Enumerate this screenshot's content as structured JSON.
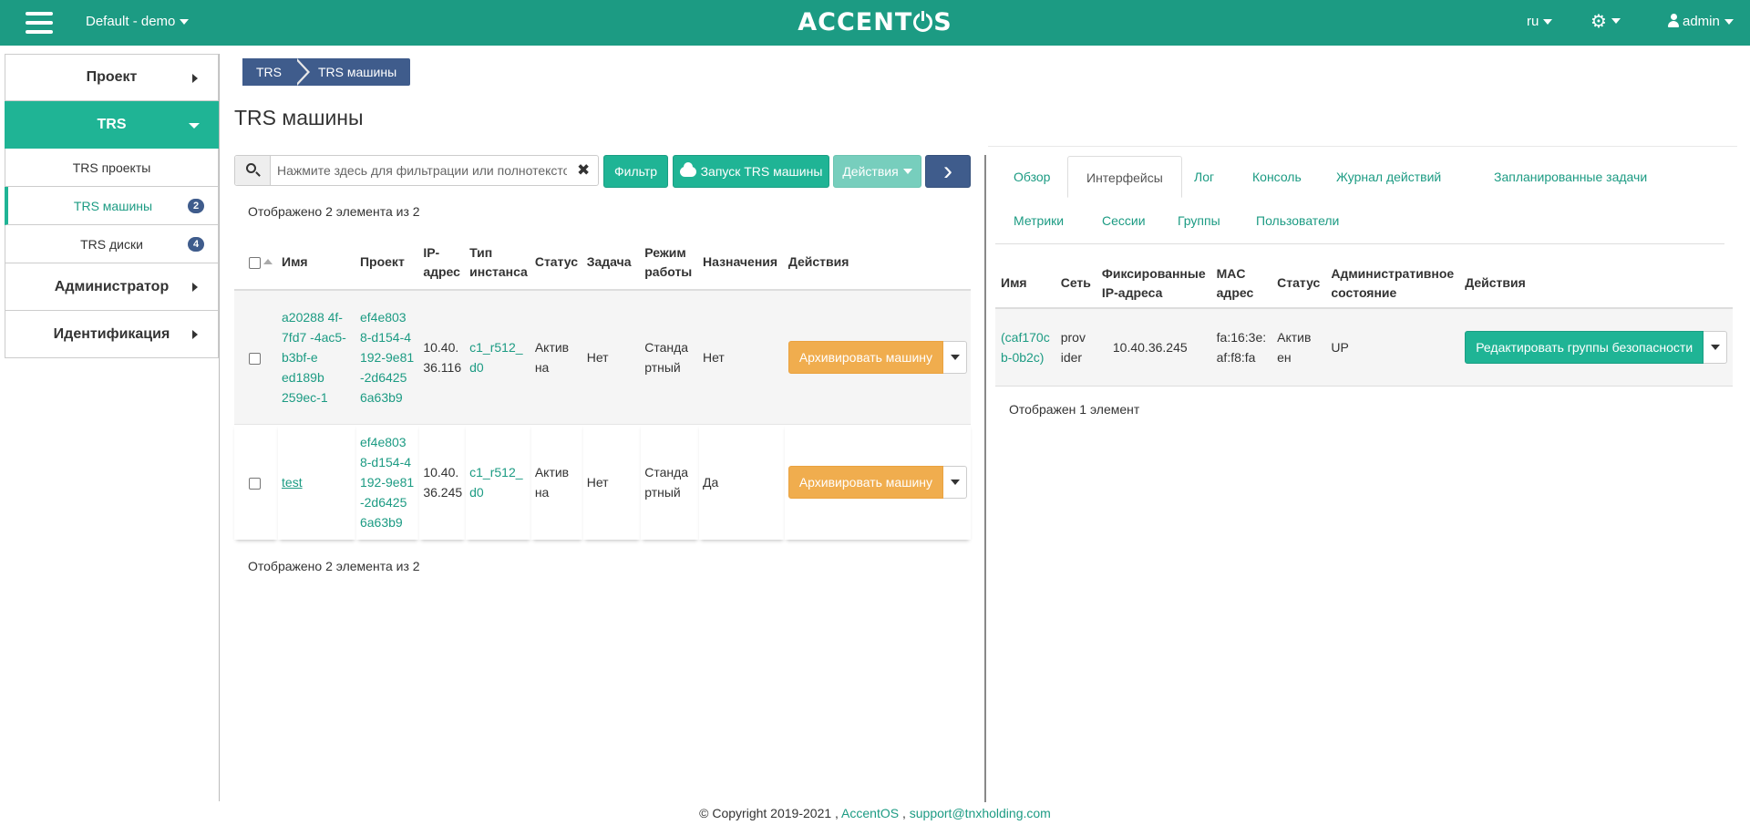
{
  "topbar": {
    "project_selector": "Default - demo",
    "logo": {
      "pre": "ACCENT",
      "post": "S"
    },
    "language": "ru",
    "user": "admin"
  },
  "sidebar": {
    "sections": [
      "Проект",
      "TRS",
      "Администратор",
      "Идентификация"
    ],
    "sub_items": [
      {
        "label": "TRS проекты"
      },
      {
        "label": "TRS машины",
        "badge": "2"
      },
      {
        "label": "TRS диски",
        "badge": "4"
      }
    ]
  },
  "breadcrumb": [
    "TRS",
    "TRS машины"
  ],
  "page_title": "TRS машины",
  "toolbar": {
    "search_placeholder": "Нажмите здесь для фильтрации или полнотекстов...",
    "filter_label": "Фильтр",
    "launch_label": "Запуск TRS машины",
    "actions_label": "Действия",
    "next_label": "›"
  },
  "instances": {
    "count_text": "Отображено 2 элемента из 2",
    "headers": [
      "Имя",
      "Проект",
      "IP-адрес",
      "Тип инстанса",
      "Статус",
      "Задача",
      "Режим работы",
      "Назначения",
      "Действия"
    ],
    "rows": [
      {
        "name": "a20288 4f-7fd7 -4ac5- b3bf-e ed189b 259ec-1",
        "project": "ef4e803 8-d154-4 192-9e81 -2d6425 6a63b9",
        "ip": "10.40. 36.116",
        "flavor": "c1_r512_ d0",
        "status": "Актив на",
        "task": "Нет",
        "mode": "Станда ртный",
        "assigned": "Нет",
        "action": "Архивировать машину"
      },
      {
        "name": "test",
        "project": "ef4e803 8-d154-4 192-9e81 -2d6425 6a63b9",
        "ip": "10.40. 36.245",
        "flavor": "c1_r512_ d0",
        "status": "Актив на",
        "task": "Нет",
        "mode": "Станда ртный",
        "assigned": "Да",
        "action": "Архивировать машину"
      }
    ]
  },
  "detail": {
    "tabs": [
      "Обзор",
      "Интерфейсы",
      "Лог",
      "Консоль",
      "Журнал действий",
      "Запланированные задачи",
      "Метрики",
      "Сессии",
      "Группы",
      "Пользователи"
    ],
    "active_tab": "Интерфейсы",
    "headers": [
      "Имя",
      "Сеть",
      "Фиксированные IP-адреса",
      "MAC адрес",
      "Статус",
      "Административное состояние",
      "Действия"
    ],
    "row": {
      "name": "(caf170c b-0b2c)",
      "network": "prov ider",
      "fixed_ip": "10.40.36.245",
      "mac": "fa:16:3e: af:f8:fa",
      "status": "Актив ен",
      "admin_state": "UP",
      "action": "Редактировать группы безопасности"
    },
    "count_text": "Отображен 1 элемент"
  },
  "footer": {
    "copyright": "© Copyright 2019-2021 ,",
    "brand": "AccentOS",
    "sep": ",",
    "email": "support@tnxholding.com"
  }
}
